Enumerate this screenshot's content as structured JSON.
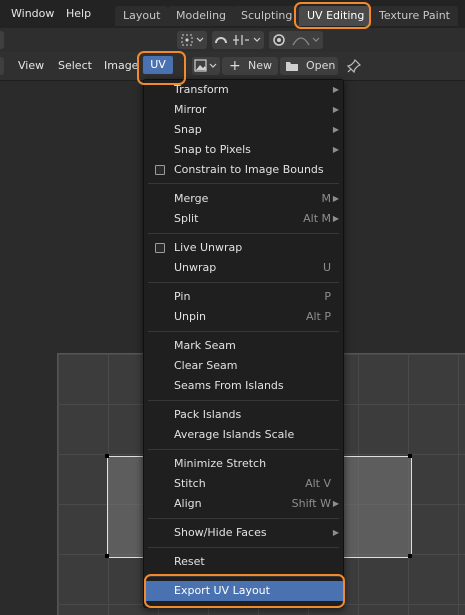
{
  "topbar": {
    "menus": [
      "Window",
      "Help"
    ],
    "workspaces": [
      "Layout",
      "Modeling",
      "Sculpting",
      "UV Editing",
      "Texture Paint"
    ],
    "active_workspace": "UV Editing"
  },
  "header": {
    "menus": [
      "View",
      "Select",
      "Image",
      "UV"
    ],
    "new_label": "New",
    "open_label": "Open"
  },
  "uv_menu": {
    "items": [
      {
        "label": "Transform",
        "shortcut": "",
        "submenu": true
      },
      {
        "label": "Mirror",
        "shortcut": "",
        "submenu": true
      },
      {
        "label": "Snap",
        "shortcut": "",
        "submenu": true
      },
      {
        "label": "Snap to Pixels",
        "shortcut": "",
        "submenu": true
      },
      {
        "label": "Constrain to Image Bounds",
        "shortcut": "",
        "checkbox": true
      },
      {
        "label": "Merge",
        "shortcut": "M",
        "submenu": true
      },
      {
        "label": "Split",
        "shortcut": "Alt M",
        "submenu": true
      },
      {
        "label": "Live Unwrap",
        "shortcut": "",
        "checkbox": true
      },
      {
        "label": "Unwrap",
        "shortcut": "U"
      },
      {
        "label": "Pin",
        "shortcut": "P"
      },
      {
        "label": "Unpin",
        "shortcut": "Alt P"
      },
      {
        "label": "Mark Seam",
        "shortcut": ""
      },
      {
        "label": "Clear Seam",
        "shortcut": ""
      },
      {
        "label": "Seams From Islands",
        "shortcut": ""
      },
      {
        "label": "Pack Islands",
        "shortcut": ""
      },
      {
        "label": "Average Islands Scale",
        "shortcut": ""
      },
      {
        "label": "Minimize Stretch",
        "shortcut": ""
      },
      {
        "label": "Stitch",
        "shortcut": "Alt V"
      },
      {
        "label": "Align",
        "shortcut": "Shift W",
        "submenu": true
      },
      {
        "label": "Show/Hide Faces",
        "shortcut": "",
        "submenu": true
      },
      {
        "label": "Reset",
        "shortcut": ""
      },
      {
        "label": "Export UV Layout",
        "shortcut": "",
        "selected": true
      }
    ]
  },
  "colors": {
    "accent": "#4a72b0",
    "highlight_ring": "#f08a2e",
    "menu_bg": "#1f1f1f"
  }
}
